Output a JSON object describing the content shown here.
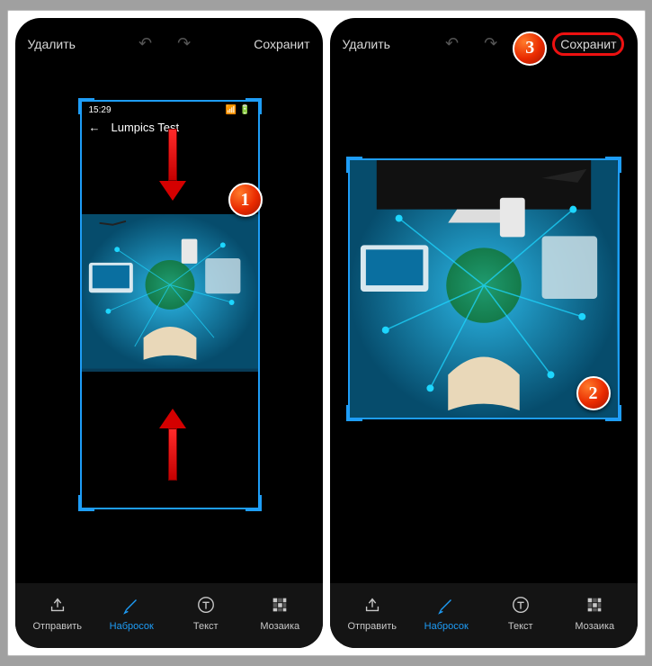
{
  "topbar": {
    "delete": "Удалить",
    "save": "Сохранит"
  },
  "screenshot": {
    "time": "15:29",
    "title": "Lumpics Test"
  },
  "badges": {
    "one": "1",
    "two": "2",
    "three": "3"
  },
  "tools": {
    "send": {
      "label": "Отправить"
    },
    "sketch": {
      "label": "Набросок"
    },
    "text": {
      "label": "Текст"
    },
    "mosaic": {
      "label": "Мозаика"
    }
  }
}
